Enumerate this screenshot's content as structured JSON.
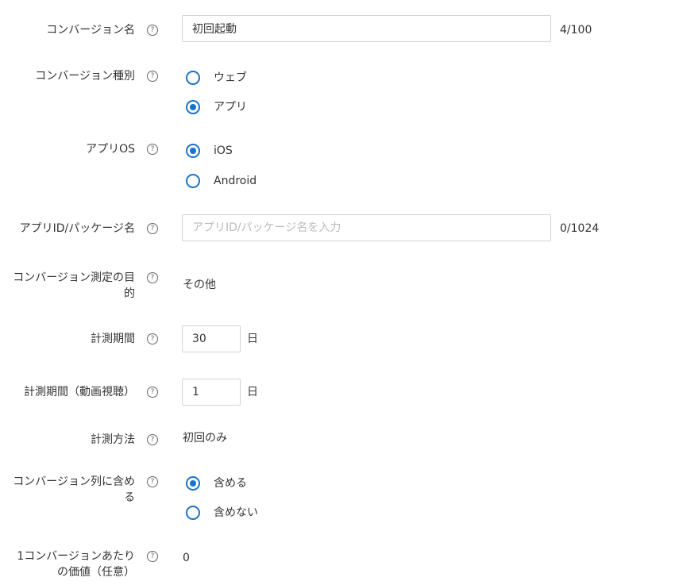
{
  "fields": {
    "conversion_name": {
      "label": "コンバージョン名",
      "value": "初回起動",
      "counter": "4/100"
    },
    "conversion_type": {
      "label": "コンバージョン種別",
      "options": [
        "ウェブ",
        "アプリ"
      ],
      "selected": "アプリ"
    },
    "app_os": {
      "label": "アプリOS",
      "options": [
        "iOS",
        "Android"
      ],
      "selected": "iOS"
    },
    "app_id": {
      "label": "アプリID/パッケージ名",
      "value": "",
      "placeholder": "アプリID/パッケージ名を入力",
      "counter": "0/1024"
    },
    "purpose": {
      "label_line1": "コンバージョン測定の目",
      "label_line2": "的",
      "value": "その他"
    },
    "period": {
      "label": "計測期間",
      "value": "30",
      "unit": "日"
    },
    "period_video": {
      "label": "計測期間（動画視聴）",
      "value": "1",
      "unit": "日"
    },
    "method": {
      "label": "計測方法",
      "value": "初回のみ"
    },
    "include_column": {
      "label_line1": "コンバージョン列に含め",
      "label_line2": "る",
      "options": [
        "含める",
        "含めない"
      ],
      "selected": "含める"
    },
    "value_per_conversion": {
      "label_line1": "1コンバージョンあたり",
      "label_line2": "の価値（任意）",
      "value": "0"
    }
  },
  "colors": {
    "accent": "#1a73c8",
    "text": "#333333",
    "border": "#d3d3d3",
    "placeholder": "#bbbbbb"
  }
}
